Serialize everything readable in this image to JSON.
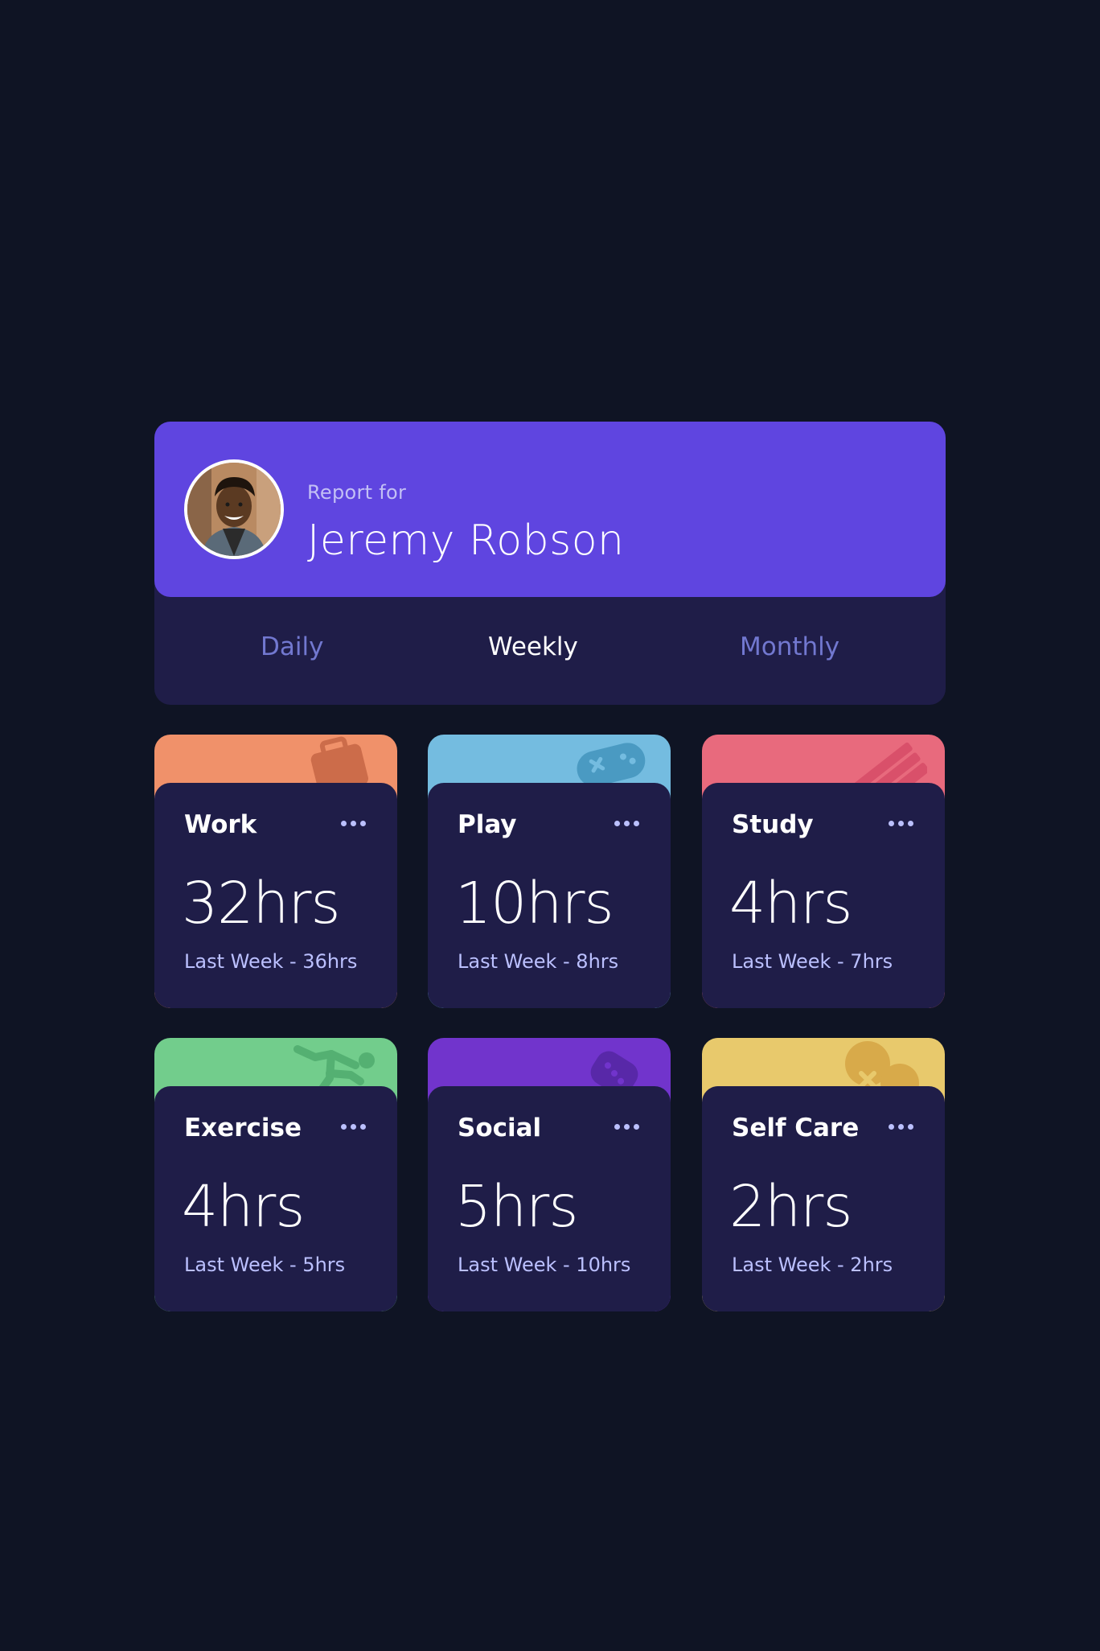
{
  "profile": {
    "report_label": "Report for",
    "name": "Jeremy Robson",
    "avatar_description": "person-photo"
  },
  "periods": [
    {
      "label": "Daily",
      "active": false
    },
    {
      "label": "Weekly",
      "active": true
    },
    {
      "label": "Monthly",
      "active": false
    }
  ],
  "activities": [
    {
      "title": "Work",
      "current": "32hrs",
      "previous": "Last Week - 36hrs",
      "color": "#f0916a",
      "icon": "briefcase-icon"
    },
    {
      "title": "Play",
      "current": "10hrs",
      "previous": "Last Week - 8hrs",
      "color": "#74bce0",
      "icon": "gamepad-icon"
    },
    {
      "title": "Study",
      "current": "4hrs",
      "previous": "Last Week - 7hrs",
      "color": "#e86a7d",
      "icon": "books-icon"
    },
    {
      "title": "Exercise",
      "current": "4hrs",
      "previous": "Last Week - 5hrs",
      "color": "#72cd8c",
      "icon": "runner-icon"
    },
    {
      "title": "Social",
      "current": "5hrs",
      "previous": "Last Week - 10hrs",
      "color": "#7134cc",
      "icon": "chat-bubble-icon"
    },
    {
      "title": "Self Care",
      "current": "2hrs",
      "previous": "Last Week - 2hrs",
      "color": "#e8c96c",
      "icon": "heart-icon"
    }
  ],
  "colors": {
    "background": "#0f1424",
    "card": "#1f1d48",
    "accent": "#5f45e0",
    "muted_text": "#7278d0",
    "pale_text": "#bbc0ff"
  }
}
